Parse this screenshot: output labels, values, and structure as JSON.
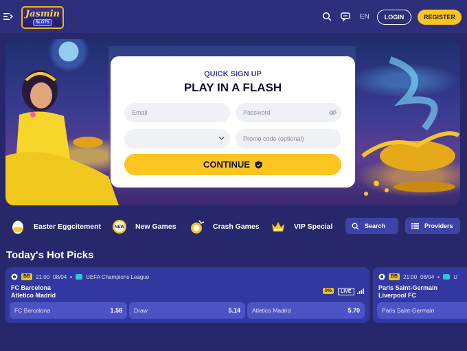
{
  "header": {
    "logo_main": "Jasmin",
    "logo_sub": "SLOTS",
    "lang": "EN",
    "login_label": "LOGIN",
    "register_label": "REGISTER"
  },
  "signup": {
    "subtitle": "QUICK SIGN UP",
    "title": "PLAY IN A FLASH",
    "email_placeholder": "Email",
    "password_placeholder": "Password",
    "currency_value": "",
    "promo_placeholder": "Promo code (optional)",
    "continue_label": "CONTINUE"
  },
  "categories": [
    {
      "label": "Easter Eggcitement",
      "icon": "easter-egg-icon"
    },
    {
      "label": "New Games",
      "icon": "new-badge-icon"
    },
    {
      "label": "Crash Games",
      "icon": "crash-icon"
    },
    {
      "label": "VIP Special",
      "icon": "crown-icon"
    }
  ],
  "search_label": "Search",
  "providers_label": "Providers",
  "hot_picks": {
    "title": "Today's Hot Picks",
    "matches": [
      {
        "badge": "BB",
        "time": "21:00",
        "date": "08/04",
        "league": "UEFA Champions League",
        "home": "FC Barcelona",
        "away": "Atletico Madrid",
        "margin": "0%",
        "live": "LIVE",
        "odds": [
          {
            "label": "FC Barcelona",
            "value": "1.58"
          },
          {
            "label": "Draw",
            "value": "5.14"
          },
          {
            "label": "Atletico Madrid",
            "value": "5.70"
          }
        ]
      },
      {
        "badge": "BB",
        "time": "21:00",
        "date": "08/04",
        "league": "U",
        "home": "Paris Saint-Germain",
        "away": "Liverpool FC",
        "odds": [
          {
            "label": "Paris Saint-Germain",
            "value": ""
          }
        ]
      }
    ]
  },
  "colors": {
    "background": "#26286b",
    "header": "#2d2f7a",
    "accent_yellow": "#fcc51f",
    "card": "#3338a0",
    "odd_button": "#4c53c4"
  }
}
